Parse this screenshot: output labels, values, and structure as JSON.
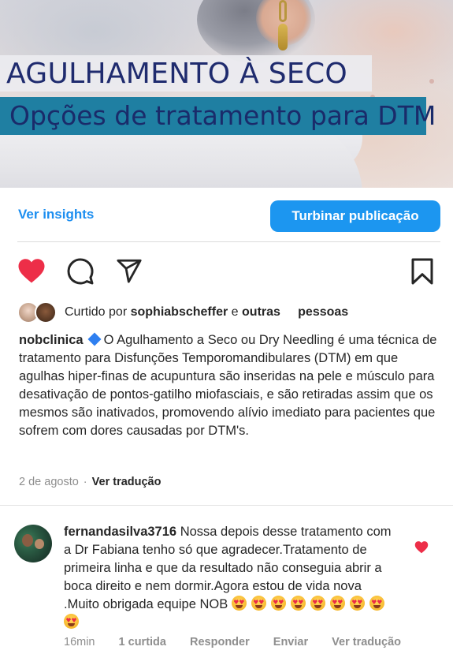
{
  "hero": {
    "title_line_1": "AGULHAMENTO À SECO",
    "title_line_2": "Opções de tratamento para DTM"
  },
  "insights": {
    "link_label": "Ver insights",
    "boost_label": "Turbinar publicação"
  },
  "actions": {
    "like_icon": "heart-filled-icon",
    "comment_icon": "comment-bubble-icon",
    "share_icon": "paper-plane-icon",
    "save_icon": "bookmark-icon",
    "like_color": "#ed2e48"
  },
  "liked_by": {
    "prefix": "Curtido por",
    "user": "sophiabscheffer",
    "connector": "e",
    "others": "outras",
    "suffix": "pessoas"
  },
  "caption": {
    "username": "nobclinica",
    "text": "O Agulhamento a Seco ou Dry Needling é uma técnica de tratamento para Disfunções Temporomandibulares (DTM) em que agulhas hiper-finas de acupuntura são inseridas na pele e músculo para desativação de pontos-gatilho miofasciais, e são retiradas assim que os mesmos são inativados, promovendo alívio imediato para pacientes que sofrem com dores causadas por DTM's."
  },
  "post_meta": {
    "date": "2 de agosto",
    "separator": "·",
    "translate": "Ver tradução"
  },
  "comment": {
    "username": "fernandasilva3716",
    "text": "Nossa depois desse tratamento com a Dr Fabiana tenho só que agradecer.Tratamento de primeira linha e que da resultado não conseguia abrir a boca direito e nem dormir.Agora estou de vida nova .Muito obrigada equipe NOB",
    "emoji_count": 9,
    "time": "16min",
    "likes": "1 curtida",
    "reply": "Responder",
    "send": "Enviar",
    "translate": "Ver tradução"
  }
}
